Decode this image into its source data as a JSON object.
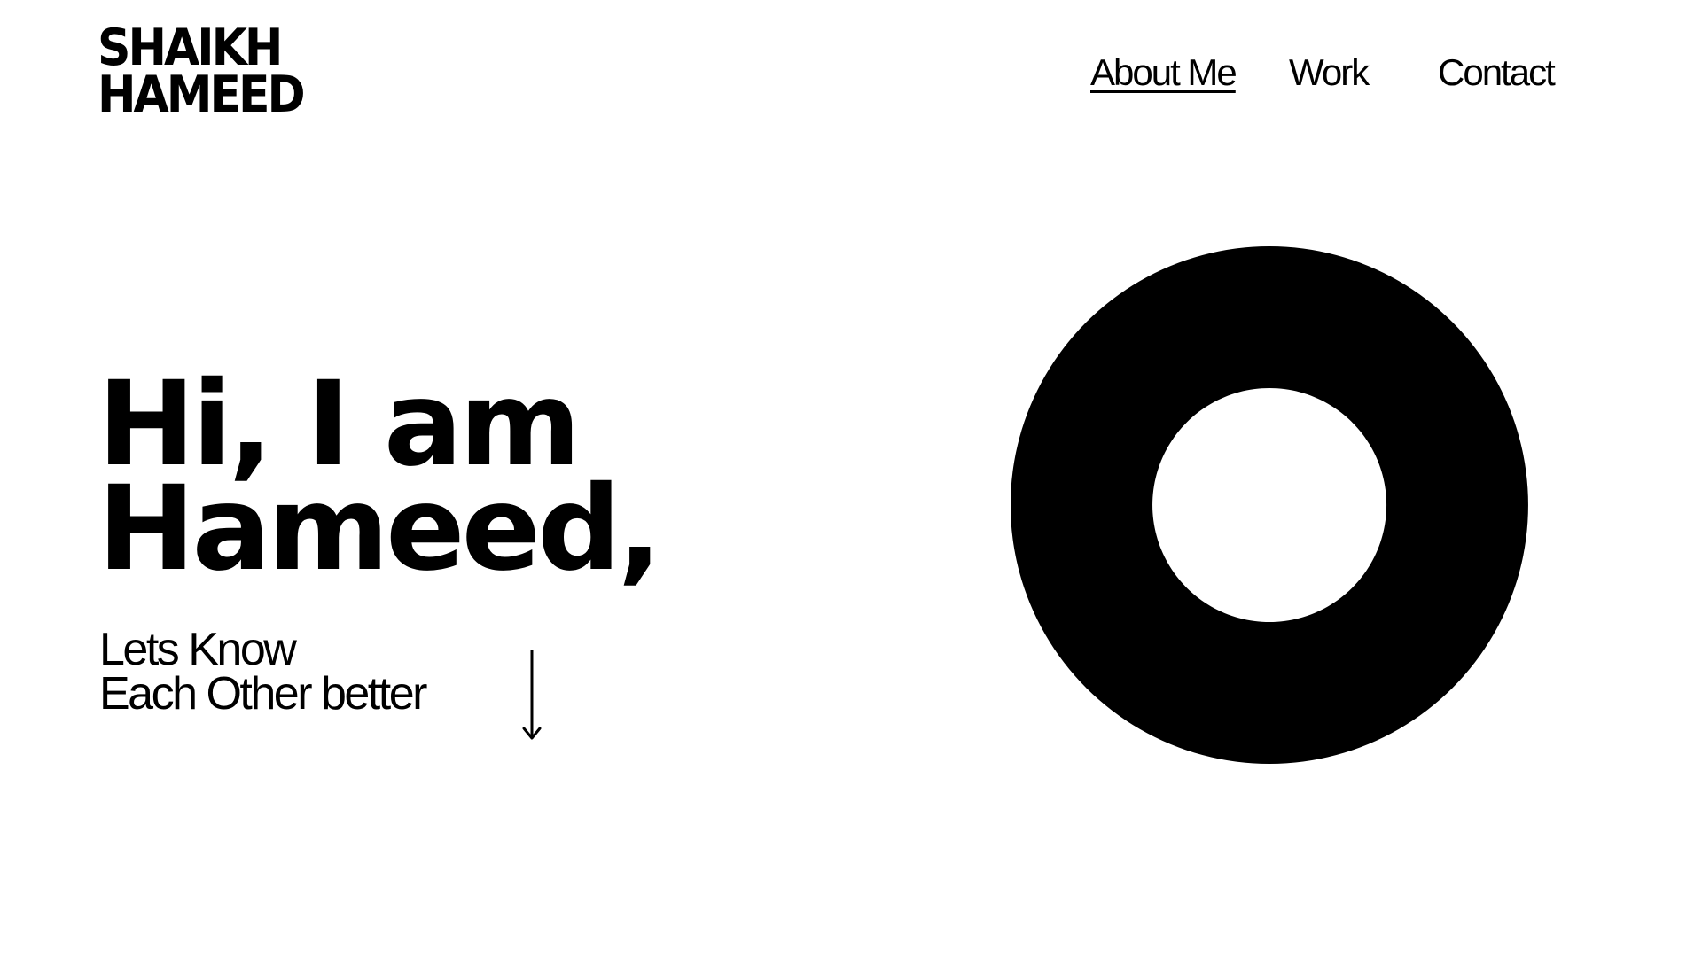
{
  "logo": {
    "line1": "SHAIKH",
    "line2": "HAMEED"
  },
  "nav": {
    "items": [
      {
        "label": "About Me",
        "active": true
      },
      {
        "label": "Work",
        "active": false
      },
      {
        "label": "Contact",
        "active": false
      }
    ]
  },
  "hero": {
    "title_line1": "Hi, I am",
    "title_line2": "Hameed,",
    "subtitle_line1": "Lets Know",
    "subtitle_line2": "Each Other better"
  },
  "icons": {
    "scroll": "arrow-down-icon",
    "graphic": "ring"
  },
  "colors": {
    "background": "#ffffff",
    "foreground": "#000000"
  }
}
